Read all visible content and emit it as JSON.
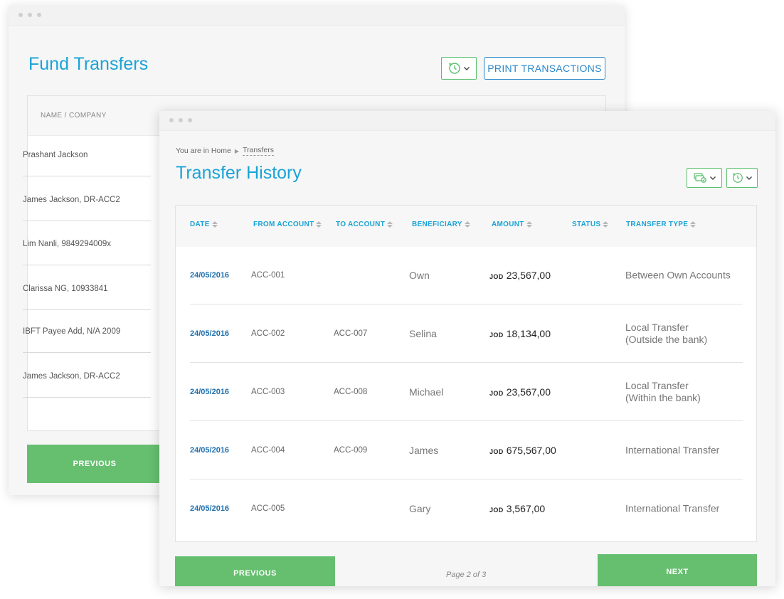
{
  "colors": {
    "accent": "#1aa3d6",
    "green": "#66bf6f",
    "link": "#1f6fad",
    "print_border": "#2a87c8"
  },
  "icons": {
    "history": "clock-history-icon",
    "cards": "card-stack-icon",
    "dropdown": "chevron-down-icon",
    "sort": "sort-arrows-icon"
  },
  "back_window": {
    "title": "Fund Transfers",
    "print_label": "PRINT TRANSACTIONS",
    "column_header": "NAME / COMPANY",
    "rows": [
      "Prashant Jackson",
      "James Jackson, DR-ACC2",
      "Lim Nanli, 9849294009x",
      "Clarissa NG, 10933841",
      "IBFT Payee Add, N/A 2009",
      "James Jackson, DR-ACC2"
    ],
    "previous_label": "PREVIOUS"
  },
  "front_window": {
    "breadcrumb": {
      "prefix": "You are in Home",
      "current": "Transfers"
    },
    "title": "Transfer History",
    "columns": [
      "DATE",
      "FROM ACCOUNT",
      "TO ACCOUNT",
      "BENEFICIARY",
      "AMOUNT",
      "STATUS",
      "TRANSFER TYPE"
    ],
    "rows": [
      {
        "date": "24/05/2016",
        "from": "ACC-001",
        "to": "",
        "beneficiary": "Own",
        "currency": "JOD",
        "amount": "23,567,00",
        "type_line1": "Between Own Accounts",
        "type_line2": ""
      },
      {
        "date": "24/05/2016",
        "from": "ACC-002",
        "to": "ACC-007",
        "beneficiary": "Selina",
        "currency": "JOD",
        "amount": "18,134,00",
        "type_line1": "Local Transfer",
        "type_line2": "(Outside the bank)"
      },
      {
        "date": "24/05/2016",
        "from": "ACC-003",
        "to": "ACC-008",
        "beneficiary": "Michael",
        "currency": "JOD",
        "amount": "23,567,00",
        "type_line1": "Local Transfer",
        "type_line2": "(Within the bank)"
      },
      {
        "date": "24/05/2016",
        "from": "ACC-004",
        "to": "ACC-009",
        "beneficiary": "James",
        "currency": "JOD",
        "amount": "675,567,00",
        "type_line1": "International Transfer",
        "type_line2": ""
      },
      {
        "date": "24/05/2016",
        "from": "ACC-005",
        "to": "",
        "beneficiary": "Gary",
        "currency": "JOD",
        "amount": "3,567,00",
        "type_line1": "International Transfer",
        "type_line2": ""
      }
    ],
    "previous_label": "PREVIOUS",
    "page_text": "Page 2 of 3",
    "next_label": "NEXT"
  }
}
